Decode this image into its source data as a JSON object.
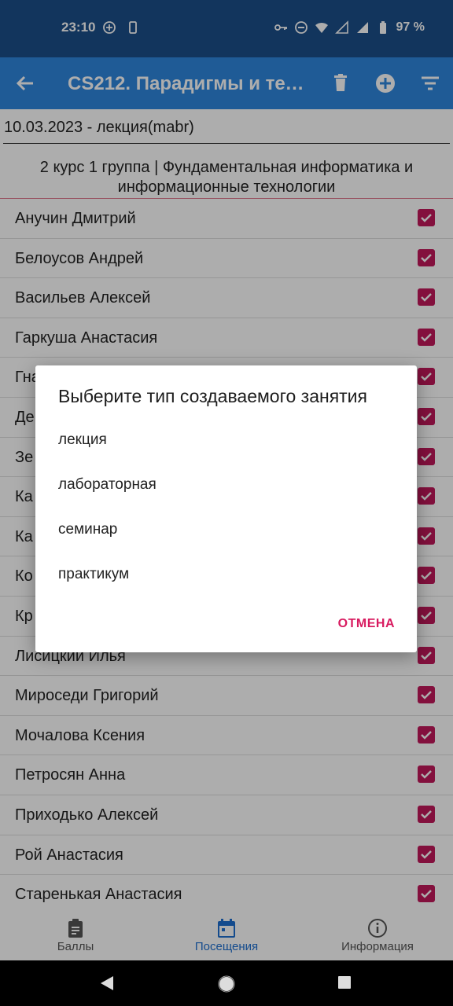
{
  "status_bar": {
    "time": "23:10",
    "battery": "97 %"
  },
  "app_bar": {
    "title": "CS212. Парадигмы и техн..."
  },
  "content": {
    "lesson_field": "10.03.2023 - лекция(mabr)",
    "group_title": "2 курс 1 группа | Фундаментальная информатика и информационные технологии",
    "students": [
      "Анучин Дмитрий",
      "Белоусов Андрей",
      "Васильев Алексей",
      "Гаркуша Анастасия",
      "Гна",
      "Де",
      "Зе",
      "Ка",
      "Ка",
      "Ко",
      "Кр",
      "Лисицкий Илья",
      "Мироседи Григорий",
      "Мочалова Ксения",
      "Петросян Анна",
      "Приходько Алексей",
      "Рой Анастасия",
      "Старенькая Анастасия"
    ]
  },
  "bottom_nav": {
    "items": [
      {
        "label": "Баллы",
        "icon": "clipboard-icon"
      },
      {
        "label": "Посещения",
        "icon": "calendar-icon"
      },
      {
        "label": "Информация",
        "icon": "info-icon"
      }
    ],
    "active_index": 1
  },
  "dialog": {
    "title": "Выберите тип создаваемого занятия",
    "options": [
      "лекция",
      "лабораторная",
      "семинар",
      "практикум"
    ],
    "cancel_label": "ОТМЕНА"
  },
  "colors": {
    "status_bar": "#1b4f8a",
    "app_bar": "#2f86de",
    "checkbox": "#c2185b",
    "accent": "#d81b60",
    "active_nav": "#1e6fd0"
  }
}
